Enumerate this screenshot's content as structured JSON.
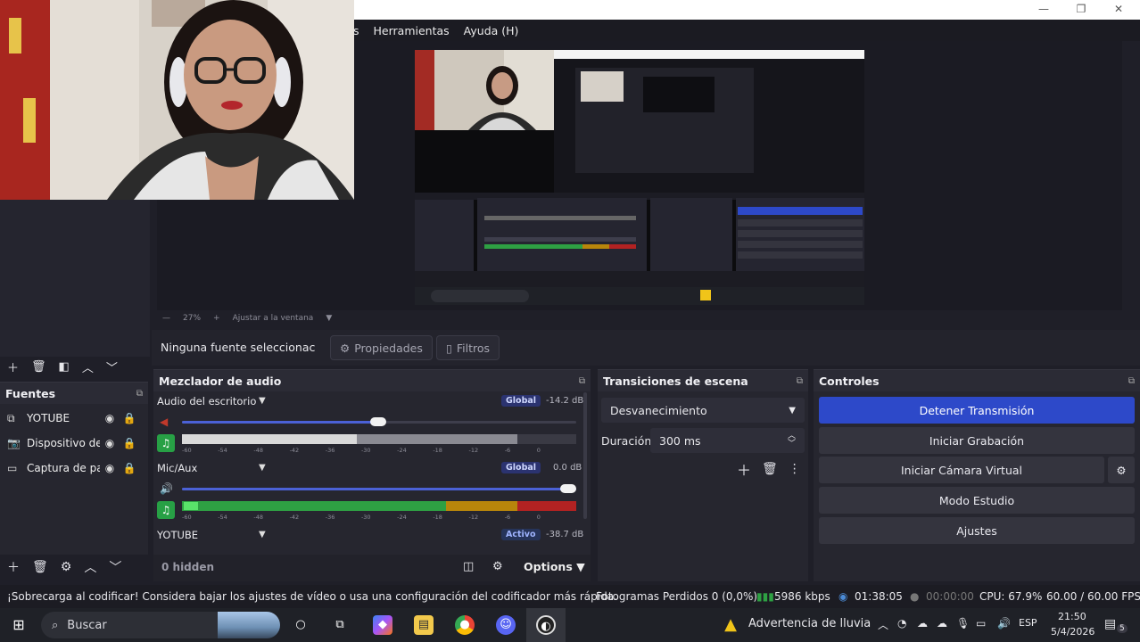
{
  "window": {
    "minimize": "—",
    "restore": "❐",
    "close": "✕"
  },
  "menu": {
    "items": [
      "s",
      "Herramientas",
      "Ayuda (H)"
    ]
  },
  "preview": {
    "zoom": "27%",
    "fit_label": "Ajustar a la ventana"
  },
  "source_bar": {
    "no_source": "Ninguna fuente seleccionac",
    "properties": "Propiedades",
    "filters": "Filtros"
  },
  "sources": {
    "title": "Fuentes",
    "items": [
      {
        "icon": "window-capture-icon",
        "name": "YOTUBE"
      },
      {
        "icon": "camera-icon",
        "name": "Dispositivo de"
      },
      {
        "icon": "monitor-icon",
        "name": "Captura de pa"
      }
    ]
  },
  "mixer": {
    "title": "Mezclador de audio",
    "hidden_label": "0 hidden",
    "channels": [
      {
        "name": "Audio del escritorio",
        "badge": "Global",
        "db": "-14.2 dB",
        "volume": 0.5,
        "muted": true
      },
      {
        "name": "Mic/Aux",
        "badge": "Global",
        "db": "0.0 dB",
        "volume": 1.0,
        "muted": false
      },
      {
        "name": "YOTUBE",
        "badge": "Activo",
        "db": "-38.7 dB"
      }
    ],
    "tick_labels": [
      "-60",
      "-54",
      "-48",
      "-42",
      "-36",
      "-30",
      "-24",
      "-18",
      "-12",
      "-6",
      "0"
    ]
  },
  "transitions": {
    "title": "Transiciones de escena",
    "selected": "Desvanecimiento",
    "duration_label": "Duración",
    "duration_value": "300 ms"
  },
  "controls": {
    "title": "Controles",
    "stop_stream": "Detener Transmisión",
    "start_record": "Iniciar Grabación",
    "start_virtual_cam": "Iniciar Cámara Virtual",
    "studio_mode": "Modo Estudio",
    "settings": "Ajustes"
  },
  "status": {
    "warning": "¡Sobrecarga al codificar! Considera bajar los ajustes de vídeo o usa una configuración del codificador más rápida.",
    "dropped": "Fotogramas Perdidos 0 (0,0%)",
    "bitrate": "5986 kbps",
    "stream_time": "01:38:05",
    "rec_time": "00:00:00",
    "cpu": "CPU: 67.9%",
    "fps": "60.00 / 60.00 FPS"
  },
  "taskbar": {
    "search_placeholder": "Buscar",
    "weather": "Advertencia de lluvia",
    "lang": "ESP",
    "time": "21:50",
    "date": "5/4/2026",
    "notifications": "5"
  },
  "colors": {
    "accent": "#2d49c9",
    "meter_green": "#2ea043",
    "meter_yellow": "#b8860b",
    "meter_red": "#b22222"
  }
}
